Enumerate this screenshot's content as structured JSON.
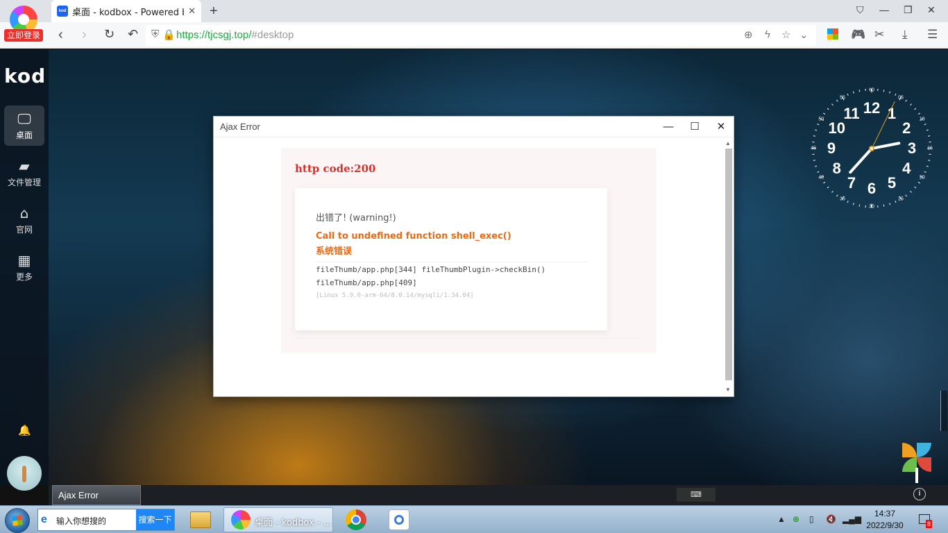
{
  "browser": {
    "brand_login": "立即登录",
    "tab_title": "桌面 - kodbox - Powered b",
    "tab_favicon": "kod",
    "url_proto": "https://",
    "url_host": "tjcsgj.top/",
    "url_hash": "#desktop"
  },
  "sidebar": {
    "logo": "kod",
    "items": [
      {
        "label": "桌面",
        "icon": "monitor-icon"
      },
      {
        "label": "文件管理",
        "icon": "folder-icon"
      },
      {
        "label": "官网",
        "icon": "home-icon"
      },
      {
        "label": "更多",
        "icon": "grid-icon"
      }
    ]
  },
  "clock": {
    "numbers": [
      "12",
      "1",
      "2",
      "3",
      "4",
      "5",
      "6",
      "7",
      "8",
      "9",
      "10",
      "11"
    ],
    "minutes": [
      "60",
      "05",
      "10",
      "15",
      "20",
      "25",
      "30",
      "35",
      "40",
      "45",
      "50",
      "55"
    ]
  },
  "dialog": {
    "title": "Ajax Error",
    "http_code": "http code:200",
    "level": "出错了! (warning!)",
    "message": "Call to undefined function shell_exec()",
    "sub_message": "系统错误",
    "trace_1": "fileThumb/app.php[344] fileThumbPlugin->checkBin()",
    "trace_2": "fileThumb/app.php[409]",
    "env": "[Linux 5.9.0-arm-64/8.0.14/mysqli/1.34.04]"
  },
  "webtask": {
    "item": "Ajax Error",
    "kbd": "⌨"
  },
  "wintask": {
    "search_placeholder": "输入你想搜的",
    "search_button": "搜索一下",
    "active_window": "桌面 - kodbox - ...",
    "time": "14:37",
    "date": "2022/9/30",
    "notify_count": "8"
  }
}
